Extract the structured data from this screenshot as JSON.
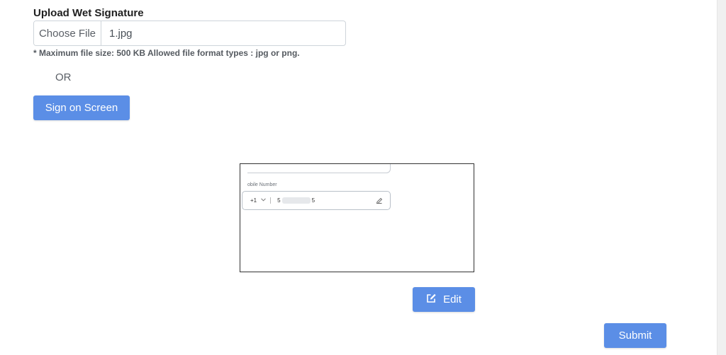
{
  "upload": {
    "label": "Upload Wet Signature",
    "choose_label": "Choose File",
    "file_name": "1.jpg",
    "hint": "* Maximum file size: 500 KB Allowed file format types : jpg or png."
  },
  "divider_text": "OR",
  "sign_button": "Sign on Screen",
  "preview": {
    "field_label": "obile Number",
    "country_code": "+1",
    "number_start": "5",
    "number_end": "5",
    "icons": [
      "chevron-down-icon",
      "pencil-icon"
    ]
  },
  "edit_button": {
    "label": "Edit",
    "icon": "edit-icon"
  },
  "submit_button": "Submit",
  "colors": {
    "primary": "#5b8ee6",
    "border": "#ced4da",
    "text_muted": "#5a5f66"
  }
}
